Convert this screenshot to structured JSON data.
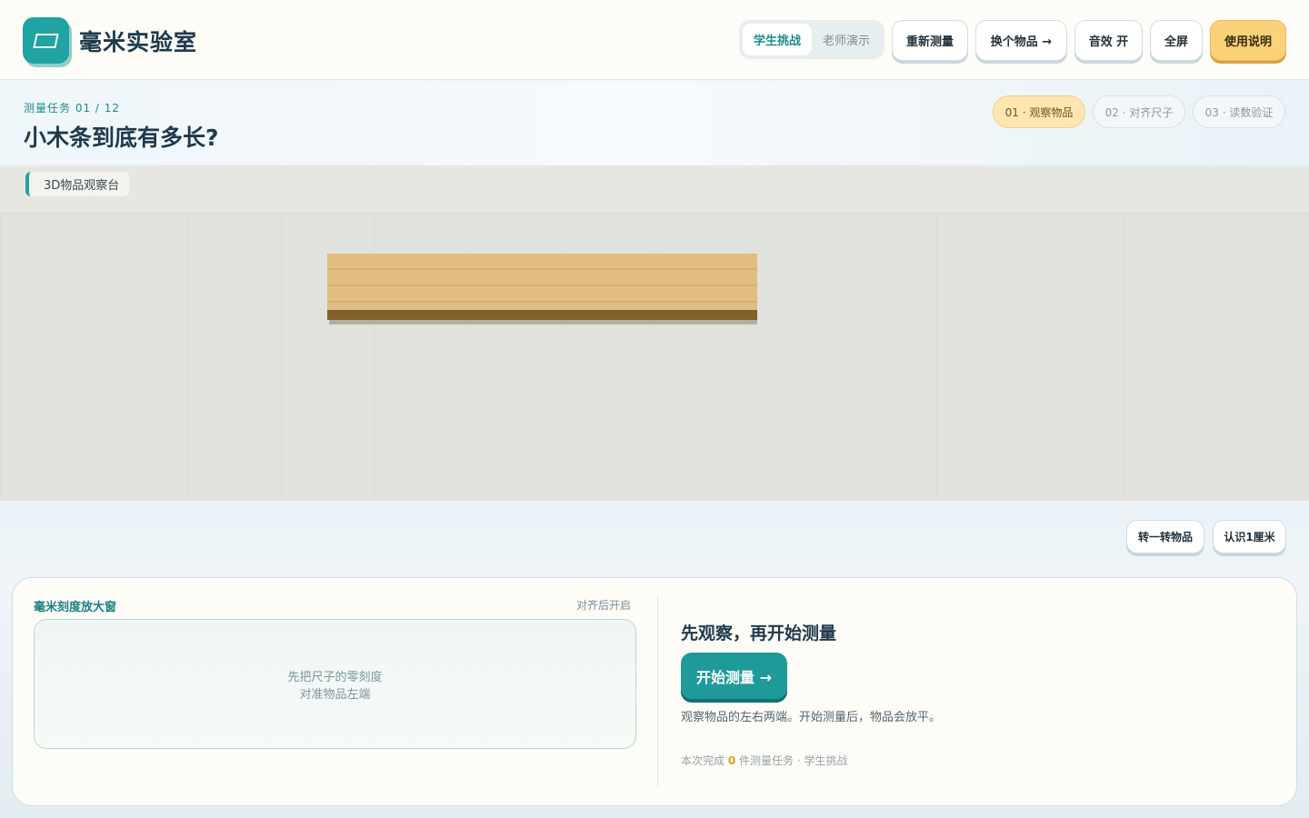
{
  "app": {
    "title": "毫米实验室",
    "icon": "parallelogram-icon"
  },
  "header": {
    "modes": [
      {
        "label": "学生挑战",
        "active": true
      },
      {
        "label": "老师演示",
        "active": false
      }
    ],
    "buttons": {
      "remeasure": "重新测量",
      "switch_item": "换个物品 →",
      "sound": "音效 开",
      "fullscreen": "全屏",
      "help": "使用说明"
    }
  },
  "task": {
    "label": "测量任务 01 / 12",
    "title": "小木条到底有多长?",
    "steps": [
      {
        "label": "01 · 观察物品",
        "active": true
      },
      {
        "label": "02 · 对齐尺子",
        "active": false
      },
      {
        "label": "03 · 读数验证",
        "active": false
      }
    ]
  },
  "stage": {
    "tag": "3D物品观察台",
    "object": "wood-stick"
  },
  "stage_actions": {
    "rotate": "转一转物品",
    "learn_cm": "认识1厘米"
  },
  "magnifier": {
    "title": "毫米刻度放大窗",
    "status": "对齐后开启",
    "hint_line1": "先把尺子的零刻度",
    "hint_line2": "对准物品左端"
  },
  "observe": {
    "title": "先观察，再开始测量",
    "start_button": "开始测量 →",
    "description": "观察物品的左右两端。开始测量后，物品会放平。",
    "stat_prefix": "本次完成",
    "stat_count": "0",
    "stat_suffix": "件测量任务 · 学生挑战"
  },
  "colors": {
    "accent": "#1fa3a3",
    "primary_button": "#fbd27a",
    "wood": "#e1bd84",
    "wood_edge": "#83602b"
  }
}
